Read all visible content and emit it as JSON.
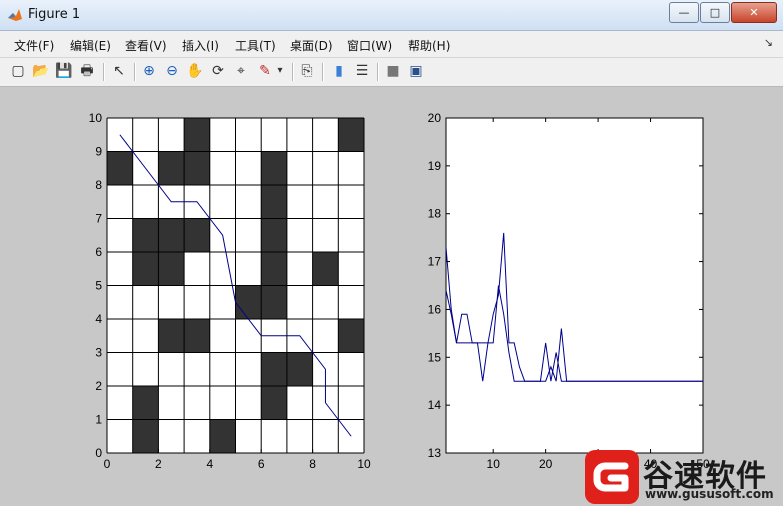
{
  "window": {
    "title": "Figure 1",
    "buttons": {
      "minimize": "—",
      "maximize": "□",
      "close": "✕"
    }
  },
  "menubar": {
    "items": [
      "文件(F)",
      "编辑(E)",
      "查看(V)",
      "插入(I)",
      "工具(T)",
      "桌面(D)",
      "窗口(W)",
      "帮助(H)"
    ],
    "overflow": "↘"
  },
  "toolbar": {
    "buttons": [
      {
        "name": "new-figure-icon",
        "glyph": "▢"
      },
      {
        "name": "open-file-icon",
        "glyph": "📂"
      },
      {
        "name": "save-icon",
        "glyph": "💾"
      },
      {
        "name": "print-icon",
        "glyph": "🖶"
      },
      {
        "name": "pointer-icon",
        "glyph": "↖"
      },
      {
        "name": "zoom-in-icon",
        "glyph": "⊕"
      },
      {
        "name": "zoom-out-icon",
        "glyph": "⊖"
      },
      {
        "name": "pan-icon",
        "glyph": "✋"
      },
      {
        "name": "rotate-3d-icon",
        "glyph": "⟳"
      },
      {
        "name": "data-cursor-icon",
        "glyph": "⌖"
      },
      {
        "name": "brush-icon",
        "glyph": "✎"
      },
      {
        "name": "brush-dropdown-icon",
        "glyph": "▾"
      },
      {
        "name": "link-plot-icon",
        "glyph": "⎘"
      },
      {
        "name": "colorbar-icon",
        "glyph": "▮"
      },
      {
        "name": "legend-icon",
        "glyph": "☰"
      },
      {
        "name": "hide-plot-tools-icon",
        "glyph": "■"
      },
      {
        "name": "show-plot-tools-icon",
        "glyph": "▣"
      }
    ]
  },
  "colors": {
    "obstacle": "#333333",
    "path_line": "#00008b",
    "watermark_red": "#e0201a"
  },
  "watermark": {
    "brand": "谷速软件",
    "url": "www.gususoft.com"
  },
  "chart_data": [
    {
      "type": "line",
      "title": "",
      "xlabel": "",
      "ylabel": "",
      "xlim": [
        0,
        10
      ],
      "ylim": [
        0,
        10
      ],
      "xticks": [
        0,
        2,
        4,
        6,
        8,
        10
      ],
      "yticks": [
        0,
        1,
        2,
        3,
        4,
        5,
        6,
        7,
        8,
        9,
        10
      ],
      "grid": "10x10 cells",
      "obstacles": [
        [
          3,
          9
        ],
        [
          9,
          9
        ],
        [
          0,
          8
        ],
        [
          2,
          8
        ],
        [
          3,
          8
        ],
        [
          6,
          8
        ],
        [
          6,
          7
        ],
        [
          1,
          6
        ],
        [
          2,
          6
        ],
        [
          3,
          6
        ],
        [
          6,
          6
        ],
        [
          1,
          5
        ],
        [
          2,
          5
        ],
        [
          6,
          5
        ],
        [
          8,
          5
        ],
        [
          5,
          4
        ],
        [
          6,
          4
        ],
        [
          2,
          3
        ],
        [
          3,
          3
        ],
        [
          9,
          3
        ],
        [
          6,
          2
        ],
        [
          7,
          2
        ],
        [
          1,
          1
        ],
        [
          6,
          1
        ],
        [
          1,
          0
        ],
        [
          4,
          0
        ]
      ],
      "series": [
        {
          "x": [
            0.5,
            1.0,
            1.5,
            2.0,
            2.5,
            3.0,
            3.5,
            4.0,
            4.5,
            5.0,
            5.5,
            6.0,
            6.5,
            7.0,
            7.5,
            8.0,
            8.5,
            8.5,
            9.0,
            9.5
          ],
          "y": [
            9.5,
            9.0,
            8.5,
            8.0,
            7.5,
            7.5,
            7.5,
            7.0,
            6.5,
            4.5,
            4.0,
            3.5,
            3.5,
            3.5,
            3.5,
            3.0,
            2.5,
            1.5,
            1.0,
            0.5
          ]
        }
      ]
    },
    {
      "type": "line",
      "title": "",
      "xlabel": "",
      "ylabel": "",
      "xlim": [
        1,
        50
      ],
      "ylim": [
        13,
        20
      ],
      "xticks": [
        10,
        20,
        30,
        40,
        50
      ],
      "yticks": [
        13,
        14,
        15,
        16,
        17,
        18,
        19,
        20
      ],
      "series": [
        {
          "x": [
            1,
            2,
            3,
            4,
            5,
            6,
            7,
            8,
            9,
            10,
            11,
            12,
            13,
            14,
            15,
            16,
            17,
            18,
            19,
            20,
            21,
            22,
            23,
            24,
            25,
            30,
            35,
            40,
            45,
            50
          ],
          "y": [
            17.3,
            16.0,
            15.3,
            15.9,
            15.9,
            15.3,
            15.3,
            14.5,
            15.3,
            15.3,
            16.5,
            15.9,
            15.1,
            14.5,
            14.5,
            14.5,
            14.5,
            14.5,
            14.5,
            15.3,
            14.5,
            15.1,
            14.5,
            14.5,
            14.5,
            14.5,
            14.5,
            14.5,
            14.5,
            14.5
          ]
        },
        {
          "x": [
            1,
            2,
            3,
            4,
            5,
            6,
            7,
            8,
            9,
            10,
            11,
            12,
            13,
            14,
            15,
            16,
            17,
            18,
            19,
            20,
            21,
            22,
            23,
            24,
            25,
            30,
            35,
            40,
            45,
            50
          ],
          "y": [
            16.4,
            15.9,
            15.3,
            15.3,
            15.3,
            15.3,
            15.3,
            15.3,
            15.3,
            15.9,
            16.3,
            17.6,
            15.3,
            15.3,
            14.8,
            14.5,
            14.5,
            14.5,
            14.5,
            14.5,
            14.8,
            14.5,
            15.6,
            14.5,
            14.5,
            14.5,
            14.5,
            14.5,
            14.5,
            14.5
          ]
        }
      ]
    }
  ]
}
